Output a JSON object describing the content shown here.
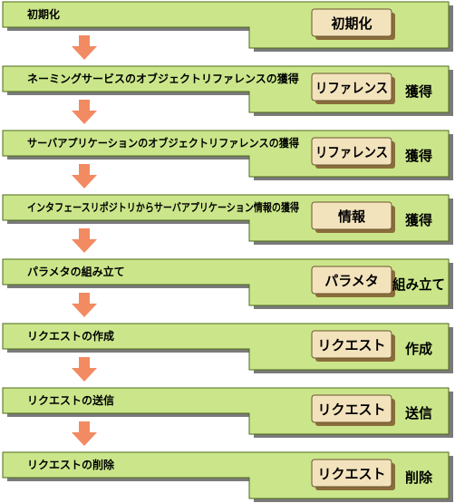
{
  "colors": {
    "panel_fill": "#cbe68a",
    "panel_shadow": "#7a7a7a",
    "panel_border": "#4d6b1a",
    "tag_fill": "#f3e3bd",
    "tag_shadow": "#8a6d3b",
    "tag_border": "#6b5530",
    "arrow": "#f28a62"
  },
  "steps": [
    {
      "label": "初期化",
      "tag": "初期化",
      "action": ""
    },
    {
      "label": "ネーミングサービスのオブジェクトリファレンスの獲得",
      "tag": "リファレンス",
      "action": "獲得"
    },
    {
      "label": "サーバアプリケーションのオブジェクトリファレンスの獲得",
      "tag": "リファレンス",
      "action": "獲得"
    },
    {
      "label": "インタフェースリポジトリからサーバアプリケーション情報の獲得",
      "tag": "情報",
      "action": "獲得"
    },
    {
      "label": "パラメタの組み立て",
      "tag": "パラメタ",
      "action": "組み立て"
    },
    {
      "label": "リクエストの作成",
      "tag": "リクエスト",
      "action": "作成"
    },
    {
      "label": "リクエストの送信",
      "tag": "リクエスト",
      "action": "送信"
    },
    {
      "label": "リクエストの削除",
      "tag": "リクエスト",
      "action": "削除"
    }
  ]
}
